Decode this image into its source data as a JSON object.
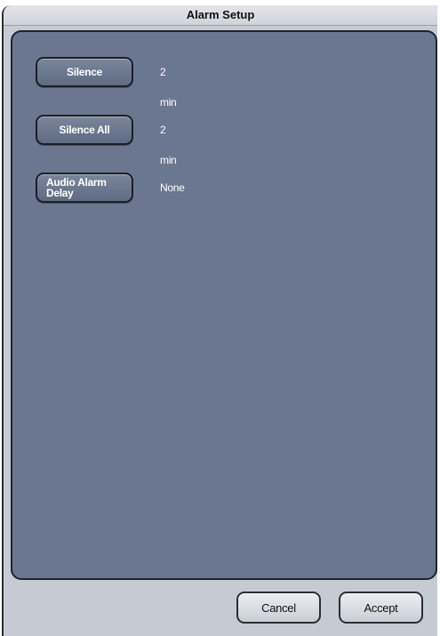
{
  "window": {
    "title": "Alarm Setup"
  },
  "settings": [
    {
      "button_label": "Silence",
      "value": "2 min"
    },
    {
      "button_label": "Silence All",
      "value": "2 min"
    },
    {
      "button_label_line1": "Audio Alarm",
      "button_label_line2": "Delay",
      "value": "None"
    }
  ],
  "footer": {
    "cancel_label": "Cancel",
    "accept_label": "Accept"
  },
  "colors": {
    "panel": "#6b7790",
    "window": "#c6cad3",
    "button": "#6b7790"
  }
}
